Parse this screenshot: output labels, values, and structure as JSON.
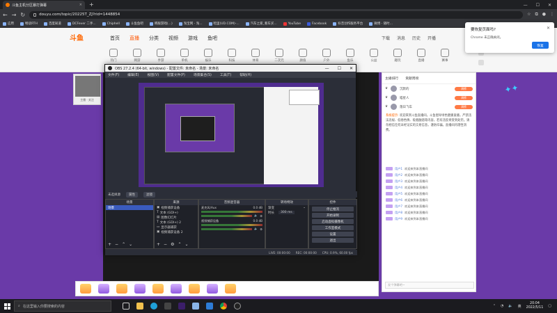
{
  "browser": {
    "tab_title": "斗鱼主机分区暴打弹幕",
    "url": "douyu.com/topic/20225T_ZJ?rid=1448854",
    "bookmarks": [
      "应用",
      "畅读RTH",
      "百度知道",
      "DCFever 二手...",
      "Chiphell",
      "斗鱼鱼吧",
      "韩服游戏(...)",
      "淘宝网 - 淘...",
      "暗里(UD.COM)-...",
      "汽车之家_看车买...",
      "YouTube",
      "Facebook",
      "抖音创作服务平台",
      "微博 - 随时..."
    ]
  },
  "site": {
    "logo": "斗鱼",
    "nav": [
      "首页",
      "直播",
      "分类",
      "视频",
      "游戏",
      "鱼吧"
    ],
    "nav_active": 1,
    "categories": [
      "热门",
      "网游",
      "手游",
      "单机",
      "娱乐",
      "科技",
      "体育",
      "二次元",
      "颜值",
      "户外",
      "鱼乐",
      "公益",
      "趣玩",
      "直播",
      "赛事",
      "更多"
    ],
    "header_right": [
      "下载",
      "消息",
      "历史",
      "开播"
    ],
    "anchor_label": "主播 · 关注"
  },
  "obs": {
    "title": "OBS 27.2.4 (64-bit, windows) - 配置文件: 未命名 - 场景: 未命名",
    "menu": [
      "文件(F)",
      "编辑(E)",
      "视图(V)",
      "配置文件(P)",
      "场景集合(S)",
      "工具(T)",
      "帮助(H)"
    ],
    "source_status": "未选择源",
    "props_btn": "属性",
    "filter_btn": "滤镜",
    "docks": {
      "scenes_title": "场景",
      "scenes": [
        "场景"
      ],
      "sources_title": "来源",
      "sources": [
        "视频捕获设备",
        "文本 (GDI+)",
        "图像幻灯片",
        "文本 (GDI+) 2",
        "显示器捕获",
        "视频捕获设备 2"
      ],
      "mixer_title": "音频混音器",
      "mixer": [
        {
          "name": "麦克风/Aux",
          "db": "0.0 dB"
        },
        {
          "name": "视频捕获设备",
          "db": "0.0 dB"
        }
      ],
      "transitions_title": "转场特效",
      "transition_value": "渐变",
      "duration_label": "时长",
      "duration_value": "300 ms",
      "controls_title": "控件",
      "controls": [
        "停止推流",
        "开始录制",
        "启动虚拟摄像机",
        "工作室模式",
        "设置",
        "退出"
      ]
    },
    "status": {
      "live": "LIVE: 00:00:00",
      "rec": "REC: 00:00:00",
      "cpu": "CPU: 0.9%, 60.00 fps"
    }
  },
  "sidebar": {
    "tabs": [
      "主播排行",
      "贡献周榜"
    ],
    "ranks": [
      {
        "name": "沉默的",
        "badge": "周榜"
      },
      {
        "name": "喵星人",
        "badge": "周榜"
      },
      {
        "name": "落日飞车",
        "badge": "周榜"
      }
    ],
    "notice_highlight": "系统提示:",
    "notice_body": "欢迎来到斗鱼直播间，斗鱼倡导绿色健康直播，严禁违法违规、低俗色情、吸烟酗酒等内容，若有违反将受到处罚。请勿相信任何未经证实的交易信息，谨防诈骗。直播间内理性消费。",
    "chat": [
      {
        "user": "用户1",
        "text": "欢迎来到本直播间"
      },
      {
        "user": "用户2",
        "text": "欢迎来到本直播间"
      },
      {
        "user": "用户3",
        "text": "欢迎来到本直播间"
      },
      {
        "user": "用户4",
        "text": "欢迎来到本直播间"
      },
      {
        "user": "用户5",
        "text": "欢迎来到本直播间"
      },
      {
        "user": "用户6",
        "text": "欢迎来到本直播间"
      },
      {
        "user": "用户7",
        "text": "欢迎来到本直播间"
      },
      {
        "user": "用户8",
        "text": "欢迎来到本直播间"
      },
      {
        "user": "用户9",
        "text": "欢迎来到本直播间"
      }
    ],
    "chat_placeholder": "发个弹幕吧~"
  },
  "popup": {
    "title": "要恢复页面吗?",
    "message": "Chrome 未正确关闭。",
    "button": "恢复"
  },
  "taskbar": {
    "search_placeholder": "在这里输入你要搜索的内容",
    "time": "20:04",
    "date": "2022/5/11",
    "tray_lang": "英"
  },
  "colors": {
    "page_bg": "#6a3aa8",
    "accent": "#ff6600",
    "obs_bg": "#2b2e38",
    "chrome_blue": "#1a73e8"
  }
}
